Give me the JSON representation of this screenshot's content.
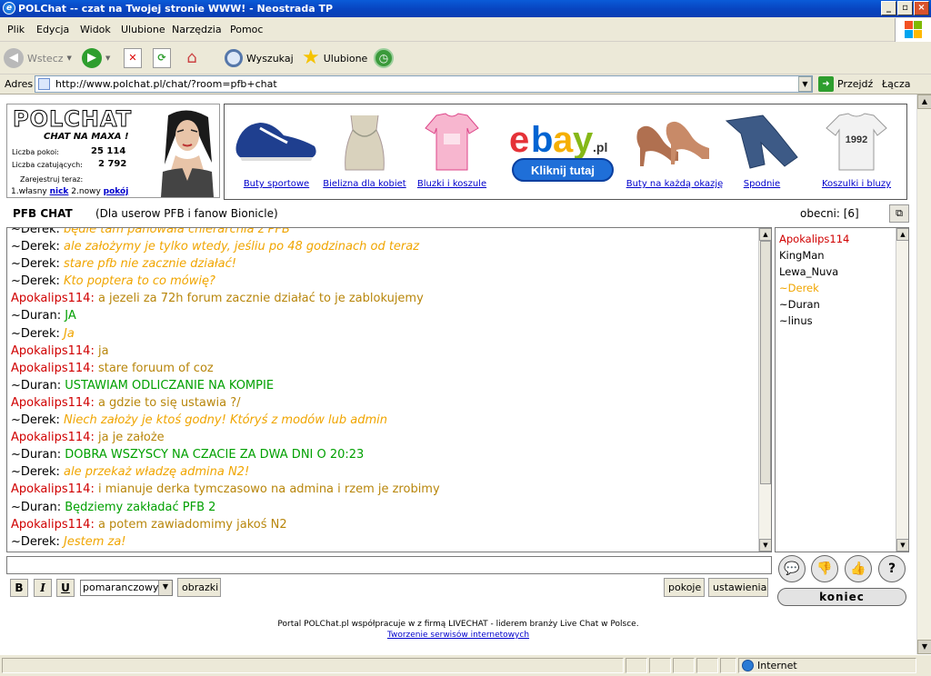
{
  "window": {
    "title": "POLChat -- czat na Twojej stronie WWW! - Neostrada TP"
  },
  "menu": [
    "Plik",
    "Edycja",
    "Widok",
    "Ulubione",
    "Narzędzia",
    "Pomoc"
  ],
  "toolbar": {
    "back": "Wstecz",
    "search": "Wyszukaj",
    "favorites": "Ulubione"
  },
  "address": {
    "label": "Adres",
    "url": "http://www.polchat.pl/chat/?room=pfb+chat",
    "go": "Przejdź",
    "links": "Łącza"
  },
  "logo": {
    "title": "POLCHAT",
    "subtitle": "CHAT NA MAXA !",
    "rooms_label": "Liczba pokoi:",
    "rooms_value": "25 114",
    "users_label": "Liczba czatujących:",
    "users_value": "2 792",
    "register_label": "Zarejestruj teraz:",
    "reg_prefix1": "1.własny ",
    "reg_link1": "nick",
    "reg_prefix2": " 2.nowy ",
    "reg_link2": "pokój"
  },
  "ads": {
    "items": [
      "Buty sportowe",
      "Bielizna dla kobiet",
      "Bluzki i koszule",
      "Buty na każdą okazję",
      "Spodnie",
      "Koszulki i bluzy"
    ],
    "ebay_suffix": ".pl",
    "ebay_button": "Kliknij tutaj",
    "shirt_print": "1992"
  },
  "chat": {
    "room_name": "PFB CHAT",
    "description": "(Dla userow PFB i fanow Bionicle)",
    "users_online": "obecni: [6]",
    "lines": [
      {
        "nick": "~Derek",
        "text": "będie tam panowała chierarchia z PFB",
        "style": "orange"
      },
      {
        "nick": "~Derek",
        "text": "ale założymy je tylko wtedy, jeśliu po 48 godzinach od teraz",
        "style": "orange"
      },
      {
        "nick": "~Derek",
        "text": "stare pfb nie zacznie działać!",
        "style": "orange"
      },
      {
        "nick": "~Derek",
        "text": "Kto poptera to co mówię?",
        "style": "orange"
      },
      {
        "nick": "Apokalips114",
        "text": "a jezeli za 72h forum zacznie działać to je zablokujemy",
        "style": "brown"
      },
      {
        "nick": "~Duran",
        "text": "JA",
        "style": "green"
      },
      {
        "nick": "~Derek",
        "text": "Ja",
        "style": "orange"
      },
      {
        "nick": "Apokalips114",
        "text": "ja",
        "style": "brown"
      },
      {
        "nick": "Apokalips114",
        "text": "stare foruum of coz",
        "style": "brown"
      },
      {
        "nick": "~Duran",
        "text": "USTAWIAM ODLICZANIE NA KOMPIE",
        "style": "green"
      },
      {
        "nick": "Apokalips114",
        "text": "a gdzie to się ustawia ?/",
        "style": "brown"
      },
      {
        "nick": "~Derek",
        "text": "Niech założy je ktoś godny! Któryś z modów lub admin",
        "style": "orange"
      },
      {
        "nick": "Apokalips114",
        "text": "ja je założe",
        "style": "brown"
      },
      {
        "nick": "~Duran",
        "text": "DOBRA WSZYSCY NA CZACIE ZA DWA DNI O 20:23",
        "style": "green"
      },
      {
        "nick": "~Derek",
        "text": "ale przekaż władzę admina N2!",
        "style": "orange"
      },
      {
        "nick": "Apokalips114",
        "text": "i mianuje derka tymczasowo na admina i rzem je zrobimy",
        "style": "brown"
      },
      {
        "nick": "~Duran",
        "text": "Będziemy zakładać PFB 2",
        "style": "green"
      },
      {
        "nick": "Apokalips114",
        "text": "a potem zawiadomimy jakoś N2",
        "style": "brown"
      },
      {
        "nick": "~Derek",
        "text": "Jestem za!",
        "style": "orange"
      }
    ],
    "users": [
      {
        "name": "Apokalips114",
        "color": "#d00000"
      },
      {
        "name": "KingMan",
        "color": "#000000"
      },
      {
        "name": "Lewa_Nuva",
        "color": "#000000"
      },
      {
        "name": "~Derek",
        "color": "#f0a500"
      },
      {
        "name": "~Duran",
        "color": "#000000"
      },
      {
        "name": "~linus",
        "color": "#000000"
      }
    ],
    "input_value": ""
  },
  "controls": {
    "bold": "B",
    "italic": "I",
    "underline": "U",
    "color_value": "pomaranczowy",
    "images": "obrazki",
    "rooms": "pokoje",
    "settings": "ustawienia",
    "quit": "koniec",
    "help": "?"
  },
  "footer": {
    "line1": "Portal POLChat.pl współpracuje w z firmą LIVECHAT - liderem branży Live Chat w Polsce.",
    "line2": "Tworzenie serwisów internetowych"
  },
  "status": {
    "zone": "Internet"
  },
  "colors": {
    "nick_apo": "#d00000",
    "msg_orange": "#f0a500",
    "msg_brown": "#b8860b",
    "msg_green": "#00a000",
    "title_blue": "#0a4fd0"
  }
}
